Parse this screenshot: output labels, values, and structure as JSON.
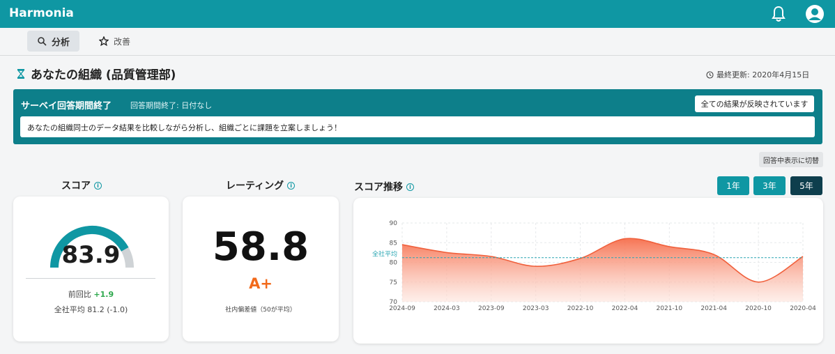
{
  "app": {
    "title": "Harmonia"
  },
  "icons": {
    "bell": "bell-icon",
    "user": "user-icon",
    "search": "search-icon",
    "star": "star-icon",
    "clock": "clock-icon",
    "info": "info-icon",
    "org": "hourglass-icon"
  },
  "colors": {
    "brand": "#0f97a3",
    "banner": "#0d7f8a",
    "dark": "#0e3e4d",
    "gauge": "#0f97a3",
    "gauge_track": "#cfd3d6",
    "positive": "#2ea84d",
    "grade": "#f26a1b",
    "area_top": "#f66e4c",
    "area_bottom": "#fde4dc",
    "avg_line": "#2aa6b3"
  },
  "tabs": [
    {
      "label": "分析"
    },
    {
      "label": "改善"
    }
  ],
  "page": {
    "title": "あなたの組織 (品質管理部)",
    "updated": "最終更新: 2020年4月15日"
  },
  "banner": {
    "title": "サーベイ回答期間終了",
    "subtitle": "回答期間終了: 日付なし",
    "button": "全ての結果が反映されています",
    "message": "あなたの組織同士のデータ結果を比較しながら分析し、組織ごとに課題を立案しましょう！"
  },
  "toggle_label": "回答中表示に切替",
  "score": {
    "title": "スコア",
    "value": "83.9",
    "gauge_fraction": 0.839,
    "prev_label": "前回比",
    "prev_delta": "+1.9",
    "avg_text": "全社平均 81.2 (-1.0)"
  },
  "rating": {
    "title": "レーティング",
    "value": "58.8",
    "grade": "A+",
    "note": "社内偏差値（50が平均）"
  },
  "trend": {
    "title": "スコア推移",
    "ranges": [
      "1年",
      "3年",
      "5年"
    ],
    "active_range": "5年"
  },
  "chart_data": {
    "type": "area",
    "x": [
      "2024-09",
      "2024-03",
      "2023-09",
      "2023-03",
      "2022-10",
      "2022-04",
      "2021-10",
      "2021-04",
      "2020-10",
      "2020-04"
    ],
    "values": [
      84.5,
      82.5,
      81.5,
      79,
      81,
      86,
      84,
      82,
      75,
      81.5
    ],
    "yticks": [
      70,
      75,
      80,
      85,
      90
    ],
    "ylim": [
      70,
      90
    ],
    "reference": {
      "label": "全社平均",
      "value": 81.2
    },
    "grid": true
  }
}
